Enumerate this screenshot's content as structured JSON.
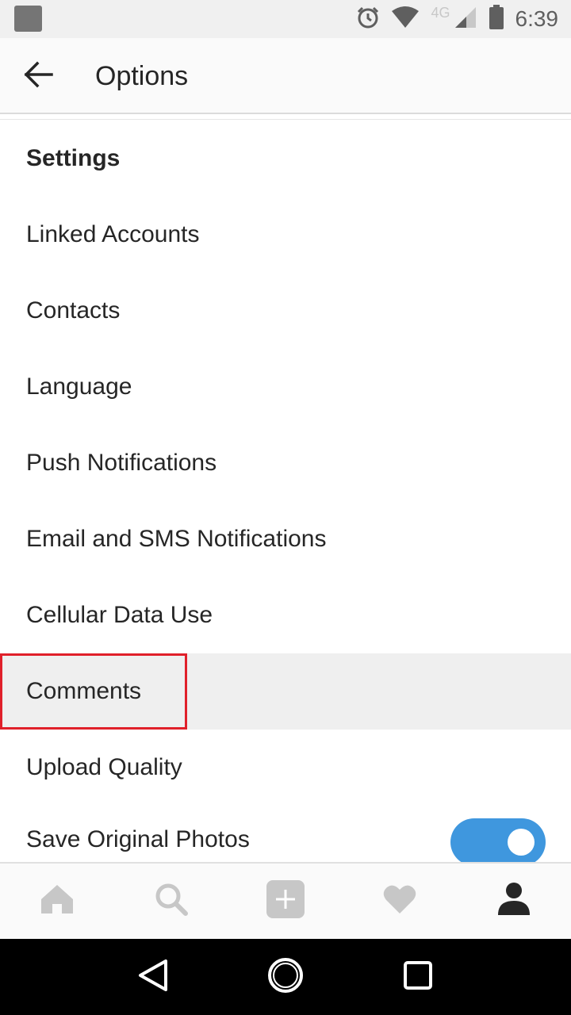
{
  "status_bar": {
    "time": "6:39",
    "network_label": "4G",
    "icons": [
      "app-notification-icon",
      "alarm-icon",
      "wifi-icon",
      "signal-icon",
      "battery-icon"
    ]
  },
  "app_bar": {
    "title": "Options",
    "back_icon": "arrow-left-icon"
  },
  "list": {
    "section_header": "Settings",
    "items": [
      {
        "label": "Linked Accounts"
      },
      {
        "label": "Contacts"
      },
      {
        "label": "Language"
      },
      {
        "label": "Push Notifications"
      },
      {
        "label": "Email and SMS Notifications"
      },
      {
        "label": "Cellular Data Use"
      },
      {
        "label": "Comments",
        "highlighted": true
      },
      {
        "label": "Upload Quality"
      },
      {
        "label": "Save Original Photos",
        "toggle": true,
        "toggle_on": true
      }
    ]
  },
  "bottom_nav": {
    "items": [
      {
        "icon": "home-icon",
        "active": false
      },
      {
        "icon": "search-icon",
        "active": false
      },
      {
        "icon": "add-post-icon",
        "active": false
      },
      {
        "icon": "heart-icon",
        "active": false
      },
      {
        "icon": "profile-icon",
        "active": true
      }
    ]
  },
  "system_nav": {
    "items": [
      "back-triangle-icon",
      "home-circle-icon",
      "recents-square-icon"
    ]
  },
  "colors": {
    "toggle_on": "#3f97de",
    "highlight_border": "#e0202a",
    "highlight_row": "#efefef",
    "text_primary": "#262626",
    "icon_inactive": "#c7c7c7"
  }
}
